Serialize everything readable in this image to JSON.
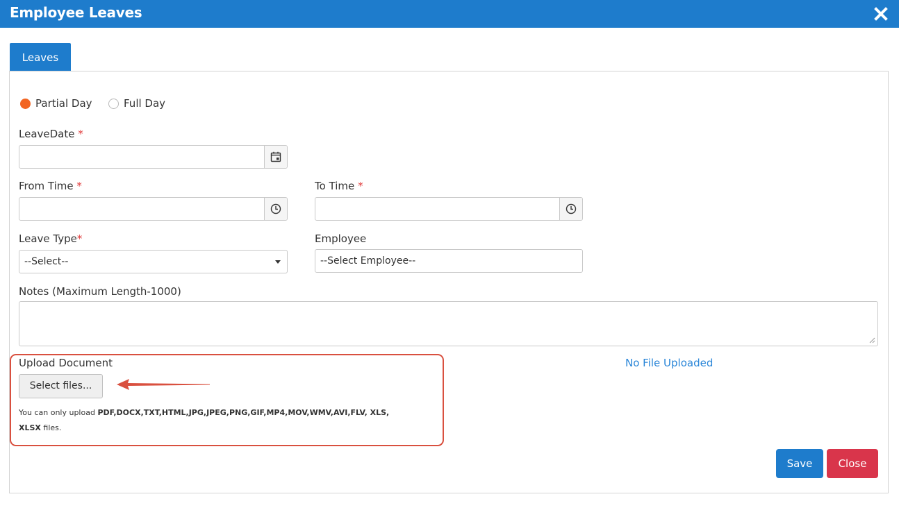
{
  "dialog": {
    "title": "Employee Leaves",
    "close_icon": "close-icon"
  },
  "tabs": [
    {
      "label": "Leaves",
      "active": true
    }
  ],
  "day_type": {
    "options": [
      {
        "label": "Partial Day",
        "selected": true
      },
      {
        "label": "Full Day",
        "selected": false
      }
    ]
  },
  "form": {
    "leave_date": {
      "label": "LeaveDate",
      "required_mark": "*",
      "value": "",
      "icon": "calendar-icon"
    },
    "from_time": {
      "label": "From Time",
      "required_mark": "*",
      "value": "",
      "icon": "clock-icon"
    },
    "to_time": {
      "label": "To Time",
      "required_mark": "*",
      "value": "",
      "icon": "clock-icon"
    },
    "leave_type": {
      "label": "Leave Type",
      "required_mark": "*",
      "selected": "--Select--"
    },
    "employee": {
      "label": "Employee",
      "selected": "--Select Employee--"
    },
    "notes": {
      "label": "Notes (Maximum Length-1000)",
      "value": ""
    }
  },
  "upload": {
    "label": "Upload Document",
    "button_label": "Select files...",
    "hint_prefix": "You can only upload ",
    "hint_types_line1": "PDF,DOCX,TXT,HTML,JPG,JPEG,PNG,GIF,MP4,MOV,WMV,AVI,FLV, XLS,",
    "hint_types_line2": "XLSX",
    "hint_suffix": " files.",
    "status": "No File Uploaded"
  },
  "actions": {
    "save_label": "Save",
    "close_label": "Close"
  },
  "colors": {
    "header": "#1e7ccc",
    "radio_selected": "#f26522",
    "required": "#e03b3b",
    "annotation": "#d9503f",
    "close_button": "#d9354b",
    "link": "#2a86d8"
  }
}
